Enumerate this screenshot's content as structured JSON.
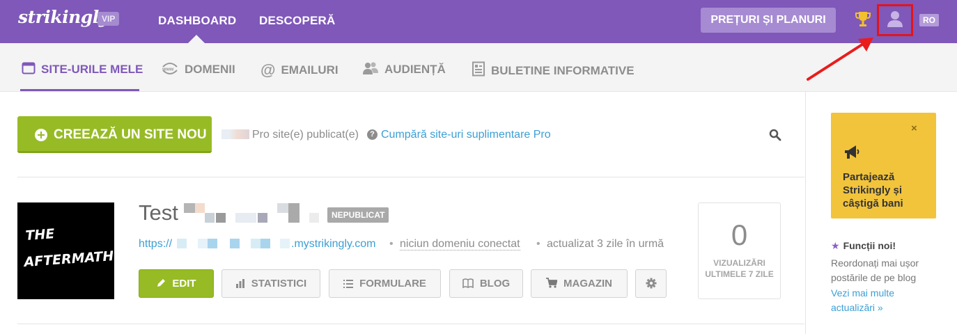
{
  "topbar": {
    "logo": "strikingly",
    "vip_badge": "VIP",
    "nav": [
      "DASHBOARD",
      "DESCOPERĂ"
    ],
    "pricing_button": "PREȚURI ȘI PLANURI",
    "language": "RO",
    "icons": [
      "trophy-icon",
      "user-icon"
    ],
    "brand_color": "#7f58b9"
  },
  "subnav": {
    "tabs": [
      {
        "label": "SITE-URILE MELE",
        "icon": "browser-icon"
      },
      {
        "label": "DOMENII",
        "icon": "www-icon"
      },
      {
        "label": "EMAILURI",
        "icon": "at-icon"
      },
      {
        "label": "AUDIENȚĂ",
        "icon": "audience-icon"
      },
      {
        "label": "BULETINE INFORMATIVE",
        "icon": "newsletter-icon"
      }
    ]
  },
  "toolbar": {
    "create_button": "CREEAZĂ UN SITE NOU",
    "pro_text": "Pro site(e) publicat(e)",
    "buy_link": "Cumpără site-uri suplimentare Pro"
  },
  "site": {
    "title": "Test",
    "status_badge": "NEPUBLICAT",
    "url_prefix": "https://",
    "url_suffix": ".mystrikingly.com",
    "domain_text": "niciun domeniu conectat",
    "updated_text": "actualizat 3 zile în urmă",
    "thumbnail_text": [
      "THE",
      "AFTERMATH"
    ],
    "buttons": {
      "edit": "EDIT",
      "stats": "STATISTICI",
      "forms": "FORMULARE",
      "blog": "BLOG",
      "store": "MAGAZIN"
    },
    "views_count": "0",
    "views_label": "VIZUALIZĂRI ULTIMELE 7 ZILE"
  },
  "sidebar": {
    "promo_close": "×",
    "promo_text": "Partajează Strikingly și câștigă bani",
    "news_title": "Funcții noi!",
    "news_text": "Reordonați mai ușor postările de pe blog",
    "news_link": "Vezi mai multe actualizări »"
  }
}
